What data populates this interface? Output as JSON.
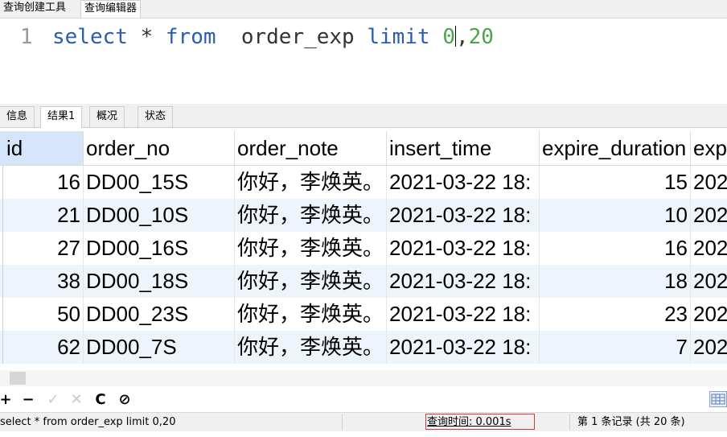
{
  "top_tabs": [
    {
      "label": "查询创建工具",
      "active": false
    },
    {
      "label": "查询编辑器",
      "active": true
    }
  ],
  "editor": {
    "line_number": "1",
    "tokens": {
      "select": "select",
      "star": "*",
      "from": "from",
      "table": "order_exp",
      "limit": "limit",
      "offset": "0",
      "comma": ",",
      "count": "20"
    }
  },
  "result_tabs": [
    {
      "label": "信息",
      "active": false
    },
    {
      "label": "结果1",
      "active": true
    },
    {
      "label": "概况",
      "active": false
    },
    {
      "label": "状态",
      "active": false
    }
  ],
  "grid": {
    "columns": [
      "id",
      "order_no",
      "order_note",
      "insert_time",
      "expire_duration",
      "exp"
    ],
    "rows": [
      {
        "id": "16",
        "order_no": "DD00_15S",
        "order_note": "你好，李焕英。",
        "insert_time": "2021-03-22 18:",
        "expire_duration": "15",
        "exp": "202"
      },
      {
        "id": "21",
        "order_no": "DD00_10S",
        "order_note": "你好，李焕英。",
        "insert_time": "2021-03-22 18:",
        "expire_duration": "10",
        "exp": "202"
      },
      {
        "id": "27",
        "order_no": "DD00_16S",
        "order_note": "你好，李焕英。",
        "insert_time": "2021-03-22 18:",
        "expire_duration": "16",
        "exp": "202"
      },
      {
        "id": "38",
        "order_no": "DD00_18S",
        "order_note": "你好，李焕英。",
        "insert_time": "2021-03-22 18:",
        "expire_duration": "18",
        "exp": "202"
      },
      {
        "id": "50",
        "order_no": "DD00_23S",
        "order_note": "你好，李焕英。",
        "insert_time": "2021-03-22 18:",
        "expire_duration": "23",
        "exp": "202"
      },
      {
        "id": "62",
        "order_no": "DD00_7S",
        "order_note": "你好，李焕英。",
        "insert_time": "2021-03-22 18:",
        "expire_duration": "7",
        "exp": "202"
      }
    ]
  },
  "toolbar": {
    "add": "+",
    "remove": "−",
    "apply": "✓",
    "discard": "✕",
    "refresh": "C",
    "stop": "⊘"
  },
  "status": {
    "sql": "select * from  order_exp limit 0,20",
    "query_time": "查询时间: 0.001s",
    "record_info": "第 1 条记录 (共 20 条)"
  },
  "colors": {
    "keyword": "#2a5db0",
    "number": "#4aa54a",
    "selected_header": "#d6e6fa",
    "alt_row": "#eef4fc",
    "highlight_box": "#d23b3b"
  }
}
